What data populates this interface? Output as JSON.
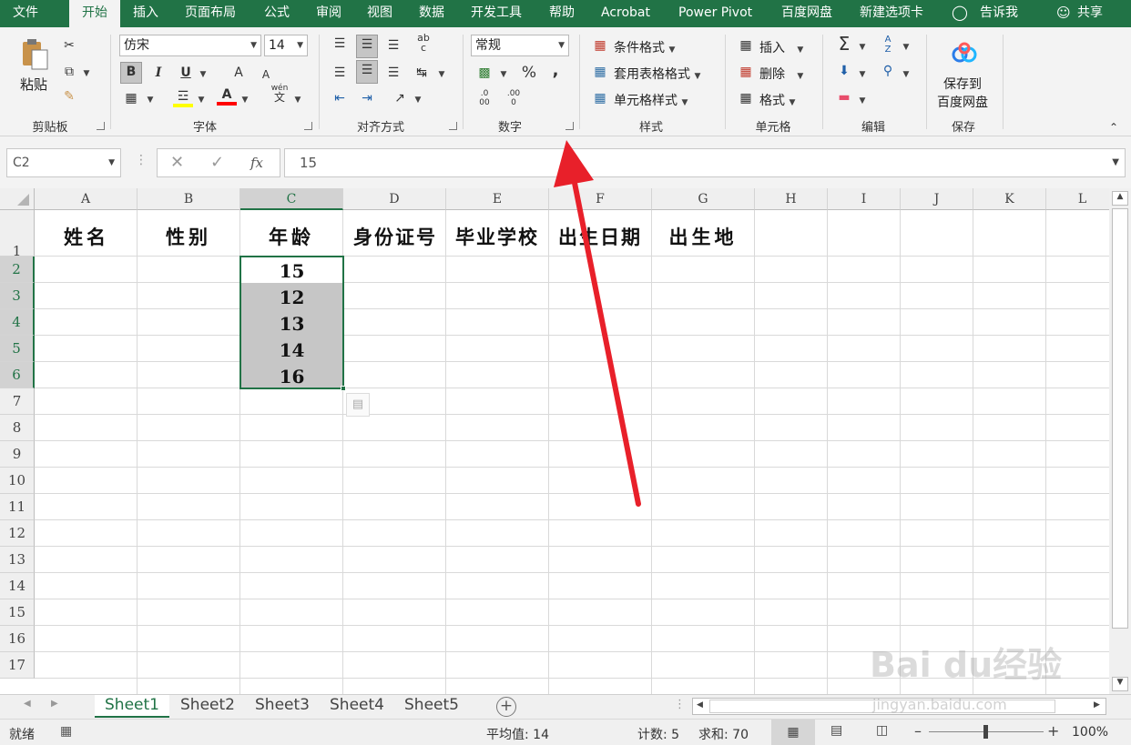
{
  "menu": {
    "tabs": [
      "文件",
      "开始",
      "插入",
      "页面布局",
      "公式",
      "审阅",
      "视图",
      "数据",
      "开发工具",
      "帮助",
      "Acrobat",
      "Power Pivot",
      "百度网盘",
      "新建选项卡"
    ],
    "active": "开始",
    "tell_me": "告诉我",
    "share": "共享"
  },
  "ribbon": {
    "clipboard": {
      "paste": "粘贴",
      "group": "剪贴板"
    },
    "font": {
      "name": "仿宋",
      "size": "14",
      "bold": "B",
      "italic": "I",
      "underline": "U",
      "grow": "A",
      "shrink": "A",
      "font_color_letter": "A",
      "wen": "wén",
      "wen2": "文",
      "group": "字体"
    },
    "alignment": {
      "group": "对齐方式",
      "wrap": "ab",
      "wrap2": "c"
    },
    "number": {
      "format": "常规",
      "percent": "%",
      "comma": ",",
      "inc": ".0",
      "inc2": "00",
      "dec": ".00",
      "dec2": "0",
      "group": "数字"
    },
    "styles": {
      "conditional": "条件格式",
      "table": "套用表格格式",
      "cell": "单元格样式",
      "group": "样式"
    },
    "cells": {
      "insert": "插入",
      "delete": "删除",
      "format": "格式",
      "group": "单元格"
    },
    "editing": {
      "sum": "Σ",
      "sort_a": "A",
      "sort_z": "Z",
      "group": "编辑"
    },
    "save": {
      "label1": "保存到",
      "label2": "百度网盘",
      "group": "保存"
    }
  },
  "formula_bar": {
    "name_box": "C2",
    "fx": "fx",
    "value": "15"
  },
  "columns": [
    "A",
    "B",
    "C",
    "D",
    "E",
    "F",
    "G",
    "H",
    "I",
    "J",
    "K",
    "L"
  ],
  "rows": [
    "1",
    "2",
    "3",
    "4",
    "5",
    "6",
    "7",
    "8",
    "9",
    "10",
    "11",
    "12",
    "13",
    "14",
    "15",
    "16",
    "17"
  ],
  "headers": [
    "姓名",
    "性别",
    "年龄",
    "身份证号",
    "毕业学校",
    "出生日期",
    "出生地"
  ],
  "ages": [
    "15",
    "12",
    "13",
    "14",
    "16"
  ],
  "sheets": [
    "Sheet1",
    "Sheet2",
    "Sheet3",
    "Sheet4",
    "Sheet5"
  ],
  "status": {
    "ready": "就绪",
    "average": "平均值: 14",
    "count": "计数: 5",
    "sum": "求和: 70",
    "zoom": "100%"
  },
  "watermark": {
    "brand": "Bai du经验",
    "url": "jingyan.baidu.com"
  },
  "colors": {
    "excel_green": "#217346",
    "arrow_red": "#e8202a",
    "selection": "#c6c6c6"
  }
}
